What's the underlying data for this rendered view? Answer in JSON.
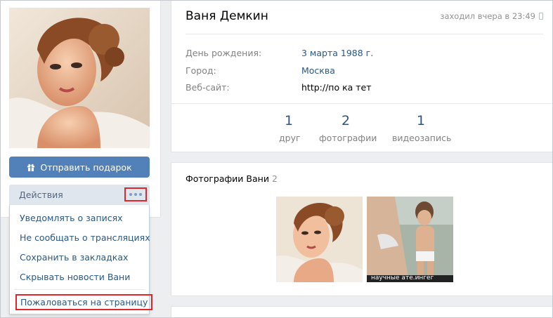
{
  "sidebar": {
    "gift_button": "Отправить подарок",
    "actions_label": "Действия",
    "menu": [
      "Уведомлять о записях",
      "Не сообщать о трансляциях",
      "Сохранить в закладках",
      "Скрывать новости Вани"
    ],
    "report": "Пожаловаться на страницу"
  },
  "profile": {
    "name": "Ваня Демкин",
    "last_seen": "заходил вчера в 23:49",
    "info": [
      {
        "label": "День рождения:",
        "value": "3 марта 1988 г."
      },
      {
        "label": "Город:",
        "value": "Москва"
      },
      {
        "label": "Веб-сайт:",
        "value": "http://по ка тет"
      }
    ],
    "counters": [
      {
        "num": "1",
        "label": "друг"
      },
      {
        "num": "2",
        "label": "фотографии"
      },
      {
        "num": "1",
        "label": "видеозапись"
      }
    ]
  },
  "photos": {
    "title": "Фотографии Вани",
    "count": "2",
    "watermark": "научные ате.ингег"
  },
  "colors": {
    "accent": "#5181b8",
    "link": "#2a5885",
    "highlight": "#e0262b",
    "background": "#edeef0"
  }
}
